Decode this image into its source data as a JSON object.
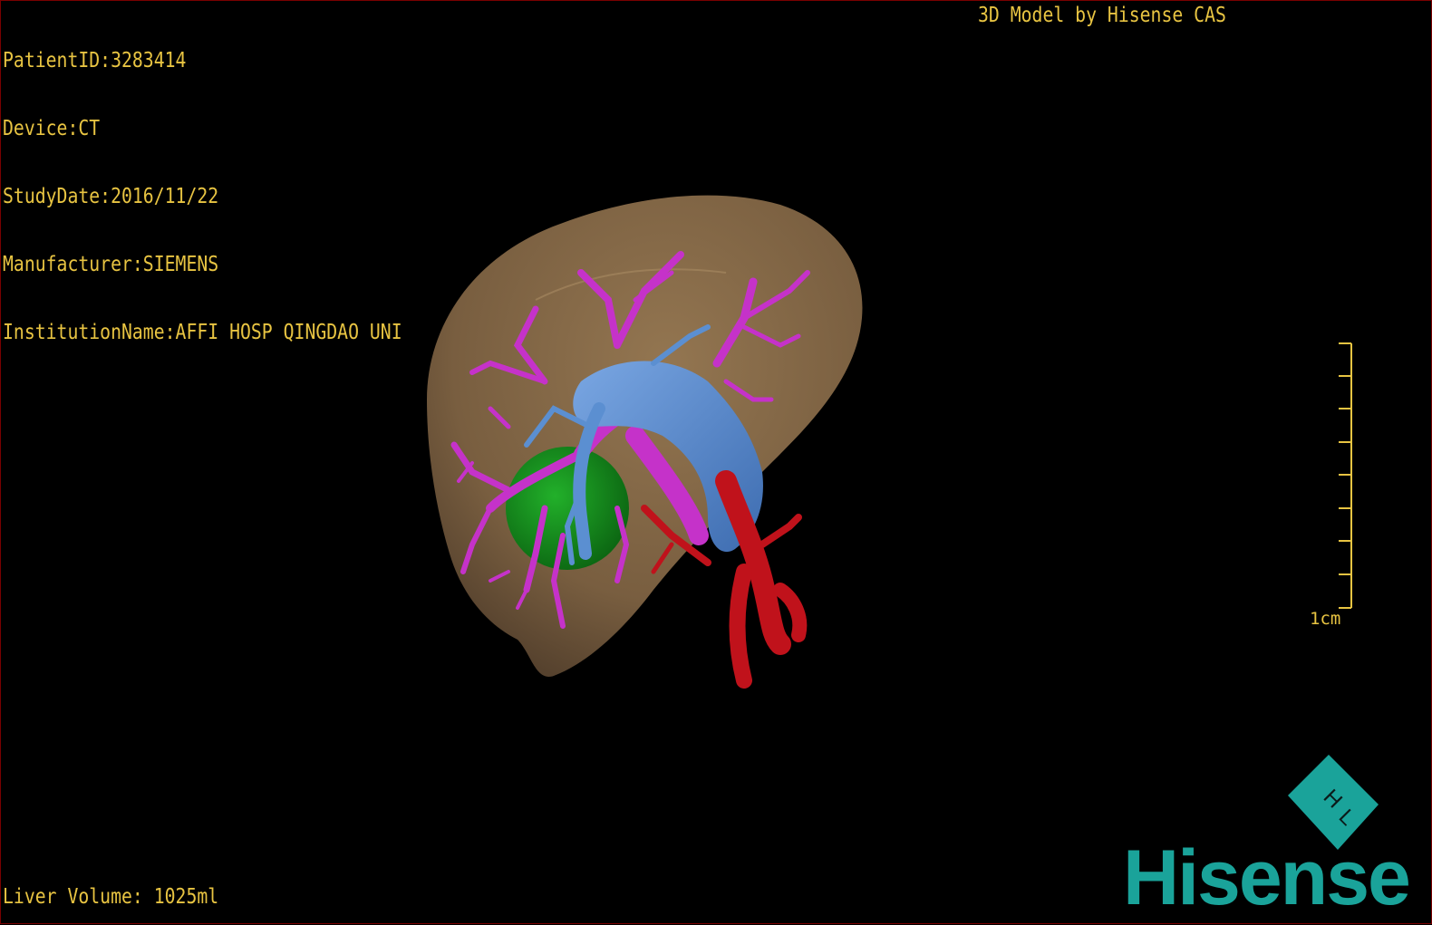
{
  "patient_info": [
    "PatientID:3283414",
    "Device:CT",
    "StudyDate:2016/11/22",
    "Manufacturer:SIEMENS",
    "InstitutionName:AFFI HOSP QINGDAO UNI"
  ],
  "header": {
    "brand_title": "3D Model by Hisense CAS"
  },
  "footer": {
    "volume": "Liver Volume: 1025ml"
  },
  "scale_bar": {
    "label": "1cm"
  },
  "logo": {
    "text": "Hisense",
    "cube_letters": "H L"
  },
  "colors": {
    "text": "#e8c442",
    "liver": "#8c6e49",
    "portal_vein": "#c532c9",
    "hepatic_vein": "#5b8fd1",
    "artery": "#c0121b",
    "gallbladder": "#0f8e18",
    "logo": "#1aa39a"
  }
}
